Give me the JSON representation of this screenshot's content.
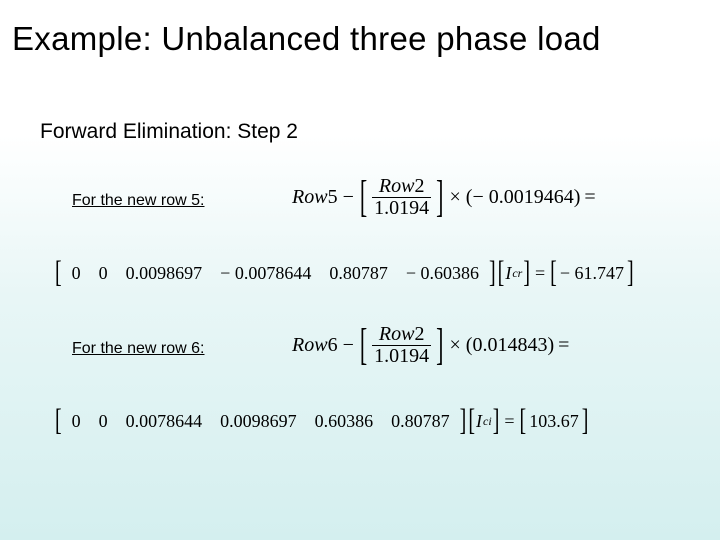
{
  "title": "Example: Unbalanced three phase load",
  "subtitle": "Forward Elimination: Step 2",
  "row5": {
    "label": "For the new row 5:",
    "formula": {
      "lead": "Row",
      "lead_n": "5",
      "minus": "−",
      "frac_num_lead": "Row",
      "frac_num_n": "2",
      "frac_den": "1.0194",
      "times": "×",
      "factor_open": "(",
      "factor_sign": "−",
      "factor_val": "0.0019464",
      "factor_close": ")",
      "tail_eq": "="
    },
    "matrix": {
      "c0": "0",
      "c1": "0",
      "c2": "0.0098697",
      "c3": "− 0.0078644",
      "c4": "0.80787",
      "c5": "− 0.60386",
      "var": "I",
      "sub": "cr",
      "eq": "=",
      "rhs_sign": "−",
      "rhs_val": "61.747"
    }
  },
  "row6": {
    "label": "For the new row 6:",
    "formula": {
      "lead": "Row",
      "lead_n": "6",
      "minus": "−",
      "frac_num_lead": "Row",
      "frac_num_n": "2",
      "frac_den": "1.0194",
      "times": "×",
      "factor_open": "(",
      "factor_val": "0.014843",
      "factor_close": ")",
      "tail_eq": "="
    },
    "matrix": {
      "c0": "0",
      "c1": "0",
      "c2": "0.0078644",
      "c3": "0.0098697",
      "c4": "0.60386",
      "c5": "0.80787",
      "var": "I",
      "sub": "ci",
      "eq": "=",
      "rhs_val": "103.67"
    }
  }
}
